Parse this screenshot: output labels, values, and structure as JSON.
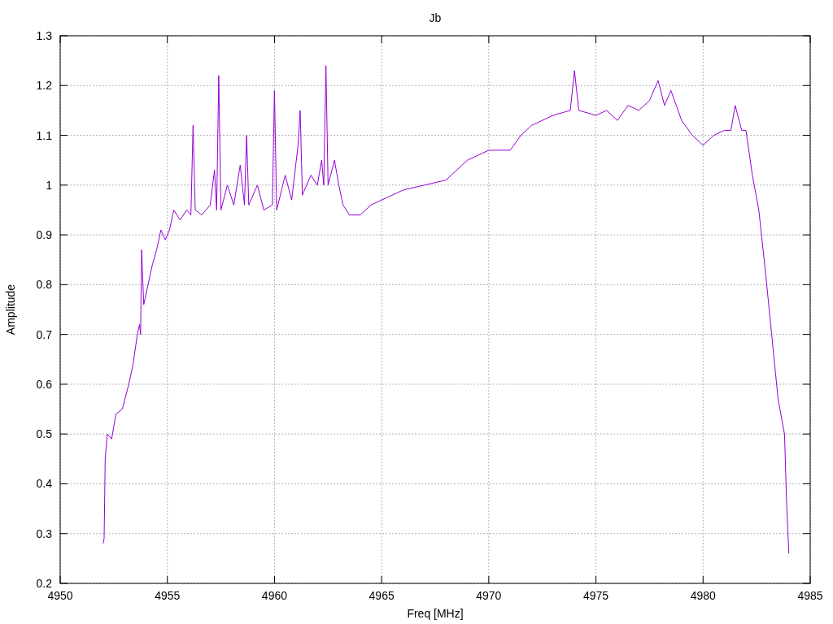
{
  "plot": {
    "chart_data": {
      "type": "line",
      "title": "Jb",
      "xlabel": "Freq [MHz]",
      "ylabel": "Amplitude",
      "grid": true,
      "xlim": [
        4950,
        4985
      ],
      "ylim": [
        0.2,
        1.3
      ],
      "xticks": [
        4950,
        4955,
        4960,
        4965,
        4970,
        4975,
        4980,
        4985
      ],
      "yticks": [
        0.2,
        0.3,
        0.4,
        0.5,
        0.6,
        0.7,
        0.8,
        0.9,
        1,
        1.1,
        1.2,
        1.3
      ],
      "x": [
        4952.0,
        4952.05,
        4952.1,
        4952.2,
        4952.4,
        4952.6,
        4952.9,
        4953.2,
        4953.4,
        4953.6,
        4953.7,
        4953.75,
        4953.8,
        4953.9,
        4954.1,
        4954.3,
        4954.5,
        4954.7,
        4954.9,
        4955.1,
        4955.3,
        4955.6,
        4955.9,
        4956.1,
        4956.2,
        4956.3,
        4956.6,
        4957.0,
        4957.2,
        4957.3,
        4957.4,
        4957.5,
        4957.8,
        4958.1,
        4958.4,
        4958.6,
        4958.7,
        4958.8,
        4959.2,
        4959.5,
        4959.9,
        4960.0,
        4960.1,
        4960.5,
        4960.8,
        4961.1,
        4961.2,
        4961.3,
        4961.7,
        4962.0,
        4962.2,
        4962.3,
        4962.4,
        4962.5,
        4962.8,
        4963.0,
        4963.2,
        4963.5,
        4964.0,
        4964.5,
        4965.0,
        4966.0,
        4967.0,
        4968.0,
        4969.0,
        4970.0,
        4971.0,
        4971.5,
        4972.0,
        4973.0,
        4973.8,
        4974.0,
        4974.2,
        4975.0,
        4975.5,
        4976.0,
        4976.5,
        4977.0,
        4977.5,
        4977.9,
        4978.2,
        4978.5,
        4979.0,
        4979.5,
        4980.0,
        4980.5,
        4981.0,
        4981.3,
        4981.5,
        4981.8,
        4982.0,
        4982.3,
        4982.6,
        4982.9,
        4983.2,
        4983.5,
        4983.8,
        4983.9,
        4984.0
      ],
      "series": [
        {
          "color": "#9400d3",
          "values": [
            0.28,
            0.29,
            0.45,
            0.5,
            0.49,
            0.54,
            0.55,
            0.6,
            0.64,
            0.7,
            0.72,
            0.7,
            0.87,
            0.76,
            0.8,
            0.84,
            0.87,
            0.91,
            0.89,
            0.91,
            0.95,
            0.93,
            0.95,
            0.94,
            1.12,
            0.95,
            0.94,
            0.96,
            1.03,
            0.95,
            1.22,
            0.95,
            1.0,
            0.96,
            1.04,
            0.96,
            1.1,
            0.96,
            1.0,
            0.95,
            0.96,
            1.19,
            0.95,
            1.02,
            0.97,
            1.08,
            1.15,
            0.98,
            1.02,
            1.0,
            1.05,
            1.0,
            1.24,
            1.0,
            1.05,
            1.0,
            0.96,
            0.94,
            0.94,
            0.96,
            0.97,
            0.99,
            1.0,
            1.01,
            1.05,
            1.07,
            1.07,
            1.1,
            1.12,
            1.14,
            1.15,
            1.23,
            1.15,
            1.14,
            1.15,
            1.13,
            1.16,
            1.15,
            1.17,
            1.21,
            1.16,
            1.19,
            1.13,
            1.1,
            1.08,
            1.1,
            1.11,
            1.11,
            1.16,
            1.11,
            1.11,
            1.02,
            0.95,
            0.83,
            0.7,
            0.57,
            0.5,
            0.36,
            0.26
          ]
        }
      ]
    }
  }
}
